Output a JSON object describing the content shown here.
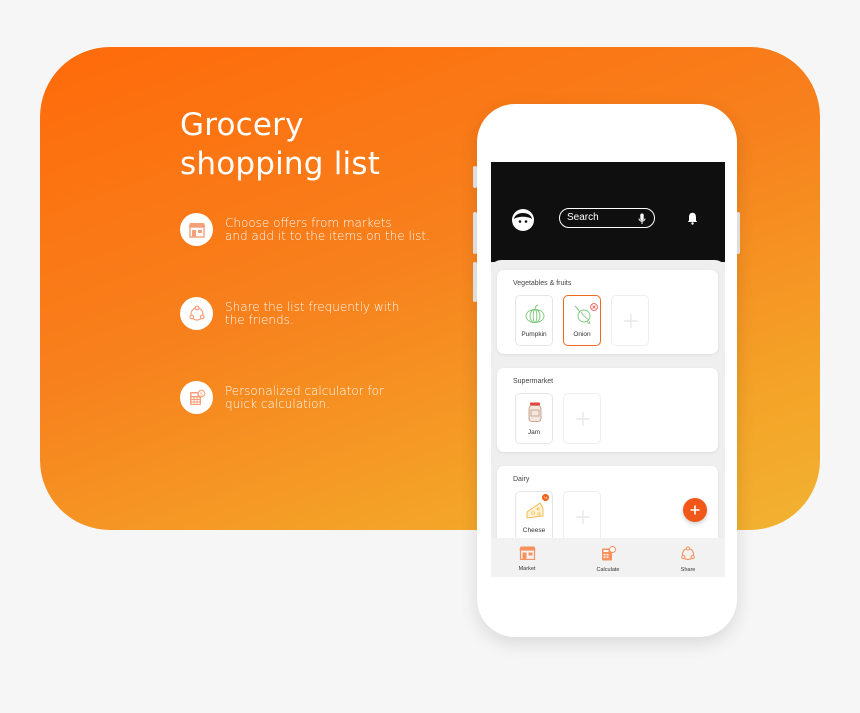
{
  "headline": {
    "line1": "Grocery",
    "line2": "shopping list"
  },
  "features": [
    {
      "icon": "market-icon",
      "lines": [
        "Choose offers from markets",
        "and add it to the items on the list."
      ]
    },
    {
      "icon": "share-icon",
      "lines": [
        "Share the list frequently with",
        "the friends."
      ]
    },
    {
      "icon": "calculator-icon",
      "lines": [
        "Personalized calculator for",
        "quick calculation."
      ]
    }
  ],
  "app": {
    "search": {
      "placeholder": "Search"
    },
    "categories": [
      {
        "title": "Vegetables & fruits",
        "items": [
          {
            "name": "Pumpkin",
            "selected": false
          },
          {
            "name": "Onion",
            "selected": true
          }
        ]
      },
      {
        "title": "Supermarket",
        "items": [
          {
            "name": "Jam",
            "selected": false
          }
        ]
      },
      {
        "title": "Dairy",
        "items": [
          {
            "name": "Cheese",
            "selected": false,
            "badge": "%"
          }
        ]
      }
    ],
    "bottom_nav": [
      {
        "label": "Market",
        "icon": "market-icon"
      },
      {
        "label": "Calculate",
        "icon": "calculator-icon"
      },
      {
        "label": "Share",
        "icon": "share-icon"
      }
    ]
  },
  "colors": {
    "accent": "#f2571a",
    "item_green": "#7cc77a",
    "dark_bar": "#0f0f0f"
  }
}
